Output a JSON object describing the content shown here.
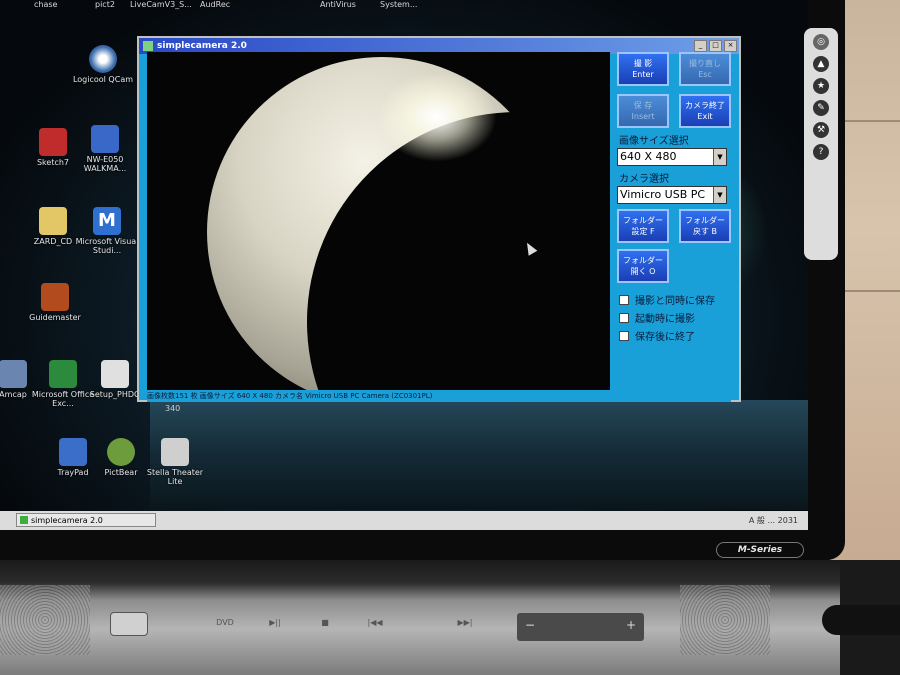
{
  "desktop": {
    "top_labels": [
      "chase",
      "pict2",
      "LiveCamV3_S...",
      "AudRec",
      "AntiVirus",
      "System..."
    ],
    "icons": [
      {
        "label": "Logicool QCam",
        "icon": "webcam-icon"
      },
      {
        "label": "Sketch7",
        "icon": "sketch-icon"
      },
      {
        "label": "NW-E050 WALKMA...",
        "icon": "walkman-icon"
      },
      {
        "label": "ZARD_CD",
        "icon": "folder-icon"
      },
      {
        "label": "Microsoft Visual Studi...",
        "icon": "visual-studio-icon"
      },
      {
        "label": "Guidemaster",
        "icon": "guidemaster-icon"
      },
      {
        "label": "Amcap",
        "icon": "amcap-icon"
      },
      {
        "label": "Microsoft Office Exc...",
        "icon": "excel-icon"
      },
      {
        "label": "Setup_PHDG",
        "icon": "setup-icon"
      },
      {
        "label": "TrayPad",
        "icon": "traypad-icon"
      },
      {
        "label": "PictBear",
        "icon": "pictbear-icon"
      },
      {
        "label": "Stella Theater Lite",
        "icon": "stella-theater-icon"
      }
    ],
    "below_window_number": "340"
  },
  "window": {
    "title": "simplecamera 2.0",
    "controls": [
      "_",
      "□",
      "×"
    ],
    "buttons": {
      "shoot": "撮 影\nEnter",
      "retake": "撮り直し\nEsc",
      "save": "保 存\nInsert",
      "camera_off": "カメラ終了\nExit",
      "folder_settings": "フォルダー\n設定  F",
      "folder_back": "フォルダー\n戻す  B",
      "folder_open": "フォルダー\n開く  O"
    },
    "image_size_label": "画像サイズ選択",
    "image_size_value": "640 X 480",
    "camera_label": "カメラ選択",
    "camera_value": "Vimicro USB PC",
    "checkboxes": [
      "撮影と同時に保存",
      "起動時に撮影",
      "保存後に終了"
    ],
    "status": "画像枚数151 枚  画像サイズ  640 X 480  カメラ名  Vimicro USB PC Camera (ZC0301PL)"
  },
  "taskbar": {
    "item": "simplecamera 2.0",
    "tray_text": "A 般 ... 2031"
  },
  "laptop": {
    "series_label": "M-Series",
    "media_buttons": [
      "DVD",
      "▶||",
      "■",
      "|◀◀",
      "▶▶|"
    ],
    "volume_minus": "−",
    "volume_plus": "+"
  },
  "sidebar_tool_icons": [
    "logo-icon",
    "upload-icon",
    "star-icon",
    "edit-icon",
    "wrench-icon",
    "help-icon"
  ]
}
